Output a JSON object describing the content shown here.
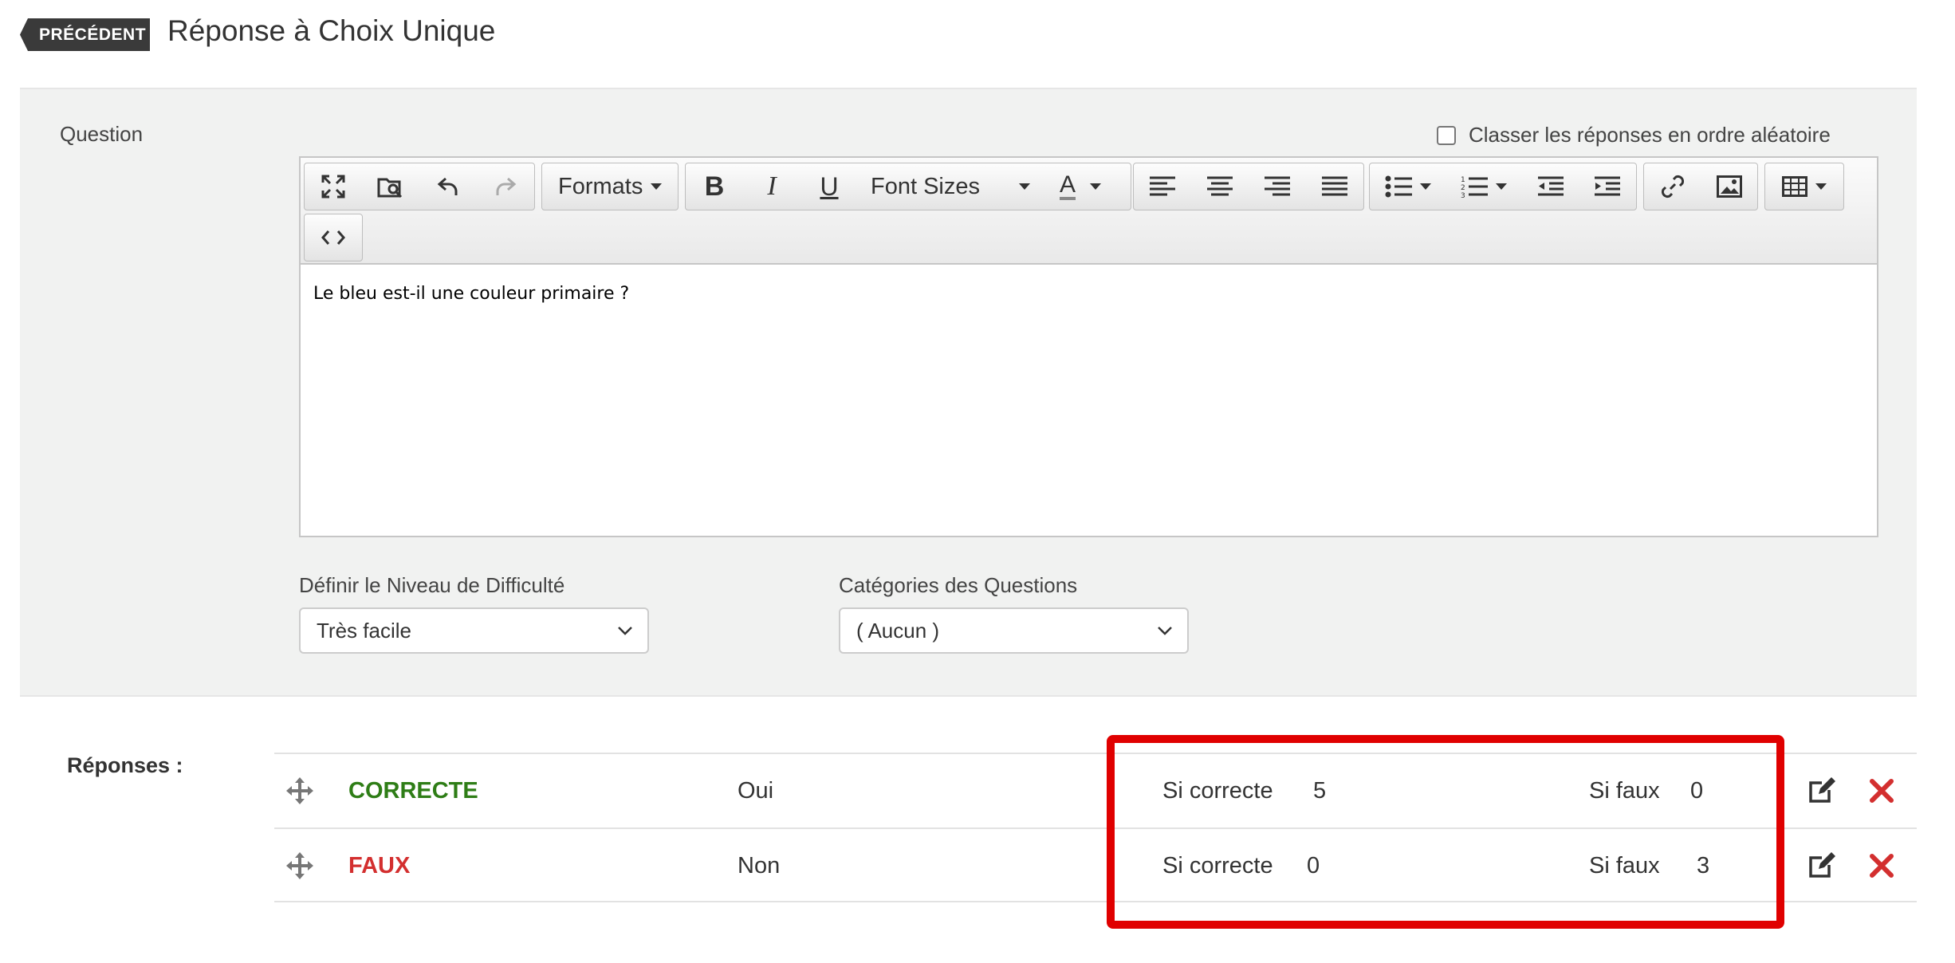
{
  "header": {
    "back_label": "PRÉCÉDENT",
    "title": "Réponse à Choix Unique"
  },
  "question": {
    "label": "Question",
    "random_order_label": "Classer les réponses en ordre aléatoire",
    "random_order_checked": false,
    "content": "Le bleu est-il une couleur primaire ?"
  },
  "toolbar": {
    "formats_label": "Formats",
    "font_sizes_label": "Font Sizes"
  },
  "difficulty": {
    "label": "Définir le Niveau de Difficulté",
    "selected": "Très facile"
  },
  "categories": {
    "label": "Catégories des Questions",
    "selected": "( Aucun )"
  },
  "answers": {
    "label": "Réponses :",
    "rows": [
      {
        "status": "CORRECTE",
        "text": "Oui",
        "if_correct_label": "Si correcte",
        "if_correct_value": "5",
        "if_false_label": "Si faux",
        "if_false_value": "0"
      },
      {
        "status": "FAUX",
        "text": "Non",
        "if_correct_label": "Si correcte",
        "if_correct_value": "0",
        "if_false_label": "Si faux",
        "if_false_value": "3"
      }
    ]
  },
  "colors": {
    "correct": "#2e7d16",
    "false": "#d32f2f",
    "highlight": "#e00000"
  }
}
